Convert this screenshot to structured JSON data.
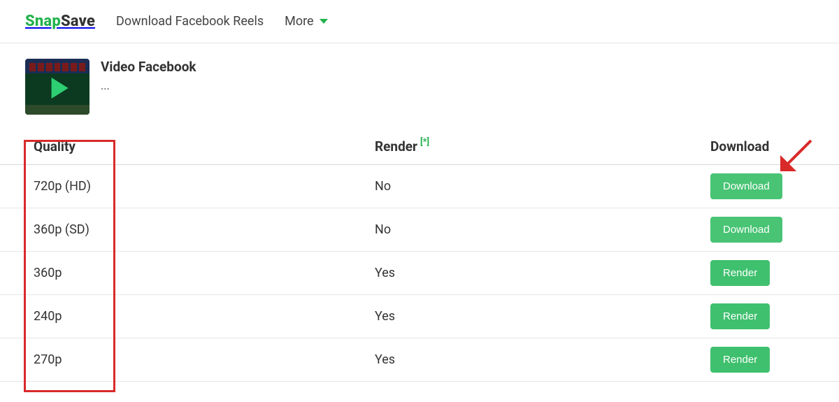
{
  "nav": {
    "logo_green": "Snap",
    "logo_dark": "Save",
    "link_reels": "Download Facebook Reels",
    "link_more": "More"
  },
  "video": {
    "title": "Video Facebook",
    "subtitle": "..."
  },
  "table": {
    "header": {
      "quality": "Quality",
      "render": "Render",
      "render_sup": "[*]",
      "download": "Download"
    },
    "rows": [
      {
        "quality": "720p (HD)",
        "render": "No",
        "action": "Download"
      },
      {
        "quality": "360p (SD)",
        "render": "No",
        "action": "Download"
      },
      {
        "quality": "360p",
        "render": "Yes",
        "action": "Render"
      },
      {
        "quality": "240p",
        "render": "Yes",
        "action": "Render"
      },
      {
        "quality": "270p",
        "render": "Yes",
        "action": "Render"
      }
    ]
  }
}
